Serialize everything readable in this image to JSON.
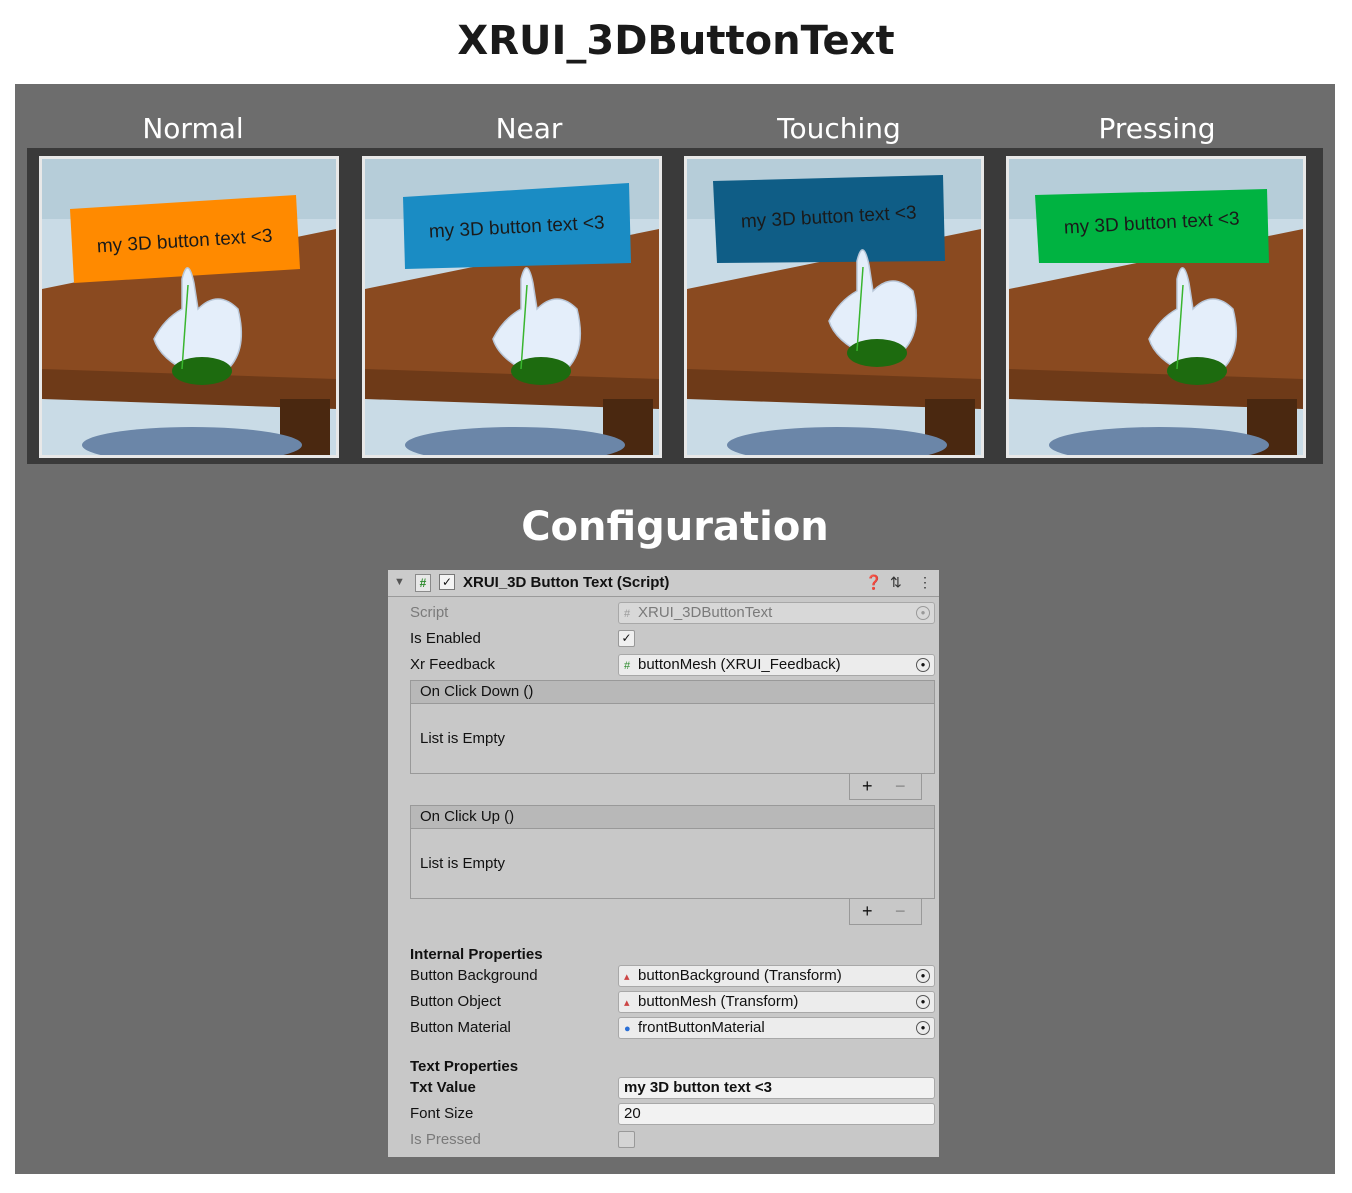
{
  "title": "XRUI_3DButtonText",
  "states": [
    {
      "label": "Normal",
      "button_color": "#ff8a00",
      "text_color": "#1a1a1a"
    },
    {
      "label": "Near",
      "button_color": "#1a8cc4",
      "text_color": "#1a1a1a"
    },
    {
      "label": "Touching",
      "button_color": "#0f5d86",
      "text_color": "#1a1a1a"
    },
    {
      "label": "Pressing",
      "button_color": "#00b341",
      "text_color": "#1a1a1a"
    }
  ],
  "button_caption": "my 3D button text <3",
  "config_title": "Configuration",
  "inspector": {
    "header_title": "XRUI_3D Button Text (Script)",
    "script_label": "Script",
    "script_value": "XRUI_3DButtonText",
    "is_enabled_label": "Is Enabled",
    "xr_feedback_label": "Xr Feedback",
    "xr_feedback_value": "buttonMesh (XRUI_Feedback)",
    "on_click_down": "On Click Down ()",
    "on_click_up": "On Click Up ()",
    "list_empty": "List is Empty",
    "internal_header": "Internal Properties",
    "button_background_label": "Button Background",
    "button_background_value": "buttonBackground (Transform)",
    "button_object_label": "Button Object",
    "button_object_value": "buttonMesh (Transform)",
    "button_material_label": "Button Material",
    "button_material_value": "frontButtonMaterial",
    "text_header": "Text Properties",
    "txt_value_label": "Txt Value",
    "txt_value": "my 3D button text <3",
    "font_size_label": "Font Size",
    "font_size_value": "20",
    "is_pressed_label": "Is Pressed"
  }
}
